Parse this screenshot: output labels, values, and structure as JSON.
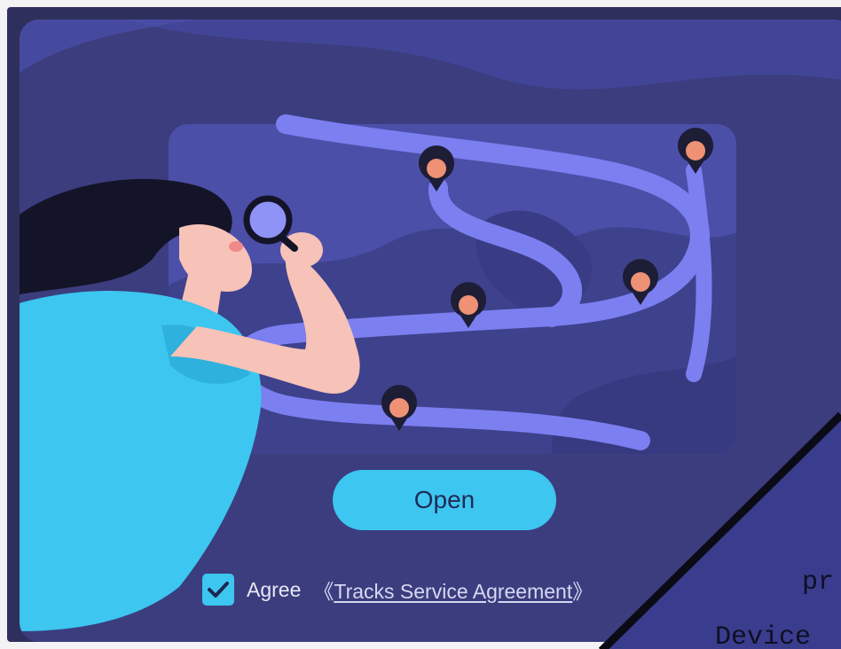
{
  "promo": {
    "open_button_label": "Open",
    "agree_label": "Agree",
    "agreement_link": {
      "open_bracket": "《",
      "text": "Tracks Service Agreement",
      "close_bracket": "》"
    },
    "agree_checked": true
  },
  "overlay": {
    "line_1": "pr",
    "line_2": "Device"
  },
  "colors": {
    "card_background": "#3b3d7e",
    "accent_button": "#3cc6f0",
    "route": "#7c7ff0",
    "pin_dot": "#ee9174",
    "pin_body": "#1d1d36"
  }
}
